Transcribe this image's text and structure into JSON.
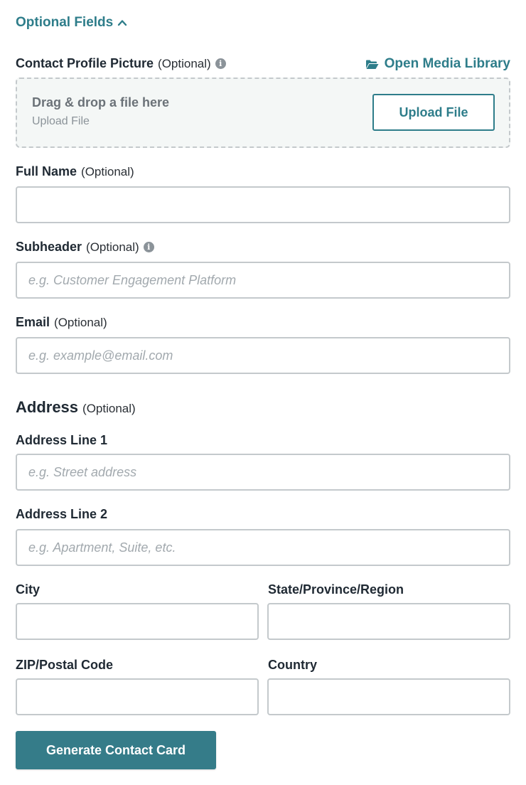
{
  "optional_toggle": {
    "label": "Optional Fields"
  },
  "profile_picture": {
    "label": "Contact Profile Picture",
    "optional": "(Optional)",
    "media_link": "Open Media Library",
    "dropzone_title": "Drag & drop a file here",
    "dropzone_sub": "Upload File",
    "upload_button": "Upload File"
  },
  "full_name": {
    "label": "Full Name",
    "optional": "(Optional)",
    "value": "",
    "placeholder": ""
  },
  "subheader": {
    "label": "Subheader",
    "optional": "(Optional)",
    "value": "",
    "placeholder": "e.g. Customer Engagement Platform"
  },
  "email": {
    "label": "Email",
    "optional": "(Optional)",
    "value": "",
    "placeholder": "e.g. example@email.com"
  },
  "address": {
    "title": "Address",
    "optional": "(Optional)",
    "line1": {
      "label": "Address Line 1",
      "value": "",
      "placeholder": "e.g. Street address"
    },
    "line2": {
      "label": "Address Line 2",
      "value": "",
      "placeholder": "e.g. Apartment, Suite, etc."
    },
    "city": {
      "label": "City",
      "value": ""
    },
    "state": {
      "label": "State/Province/Region",
      "value": ""
    },
    "zip": {
      "label": "ZIP/Postal Code",
      "value": ""
    },
    "country": {
      "label": "Country",
      "value": ""
    }
  },
  "submit": {
    "label": "Generate Contact Card"
  },
  "colors": {
    "accent": "#2e7d8a",
    "button_bg": "#357c89",
    "border": "#c4c9cc",
    "dropzone_bg": "#f4f7f6"
  },
  "icons": {
    "toggle": "chevron-up-icon",
    "media": "folder-open-icon",
    "info": "info-icon"
  }
}
